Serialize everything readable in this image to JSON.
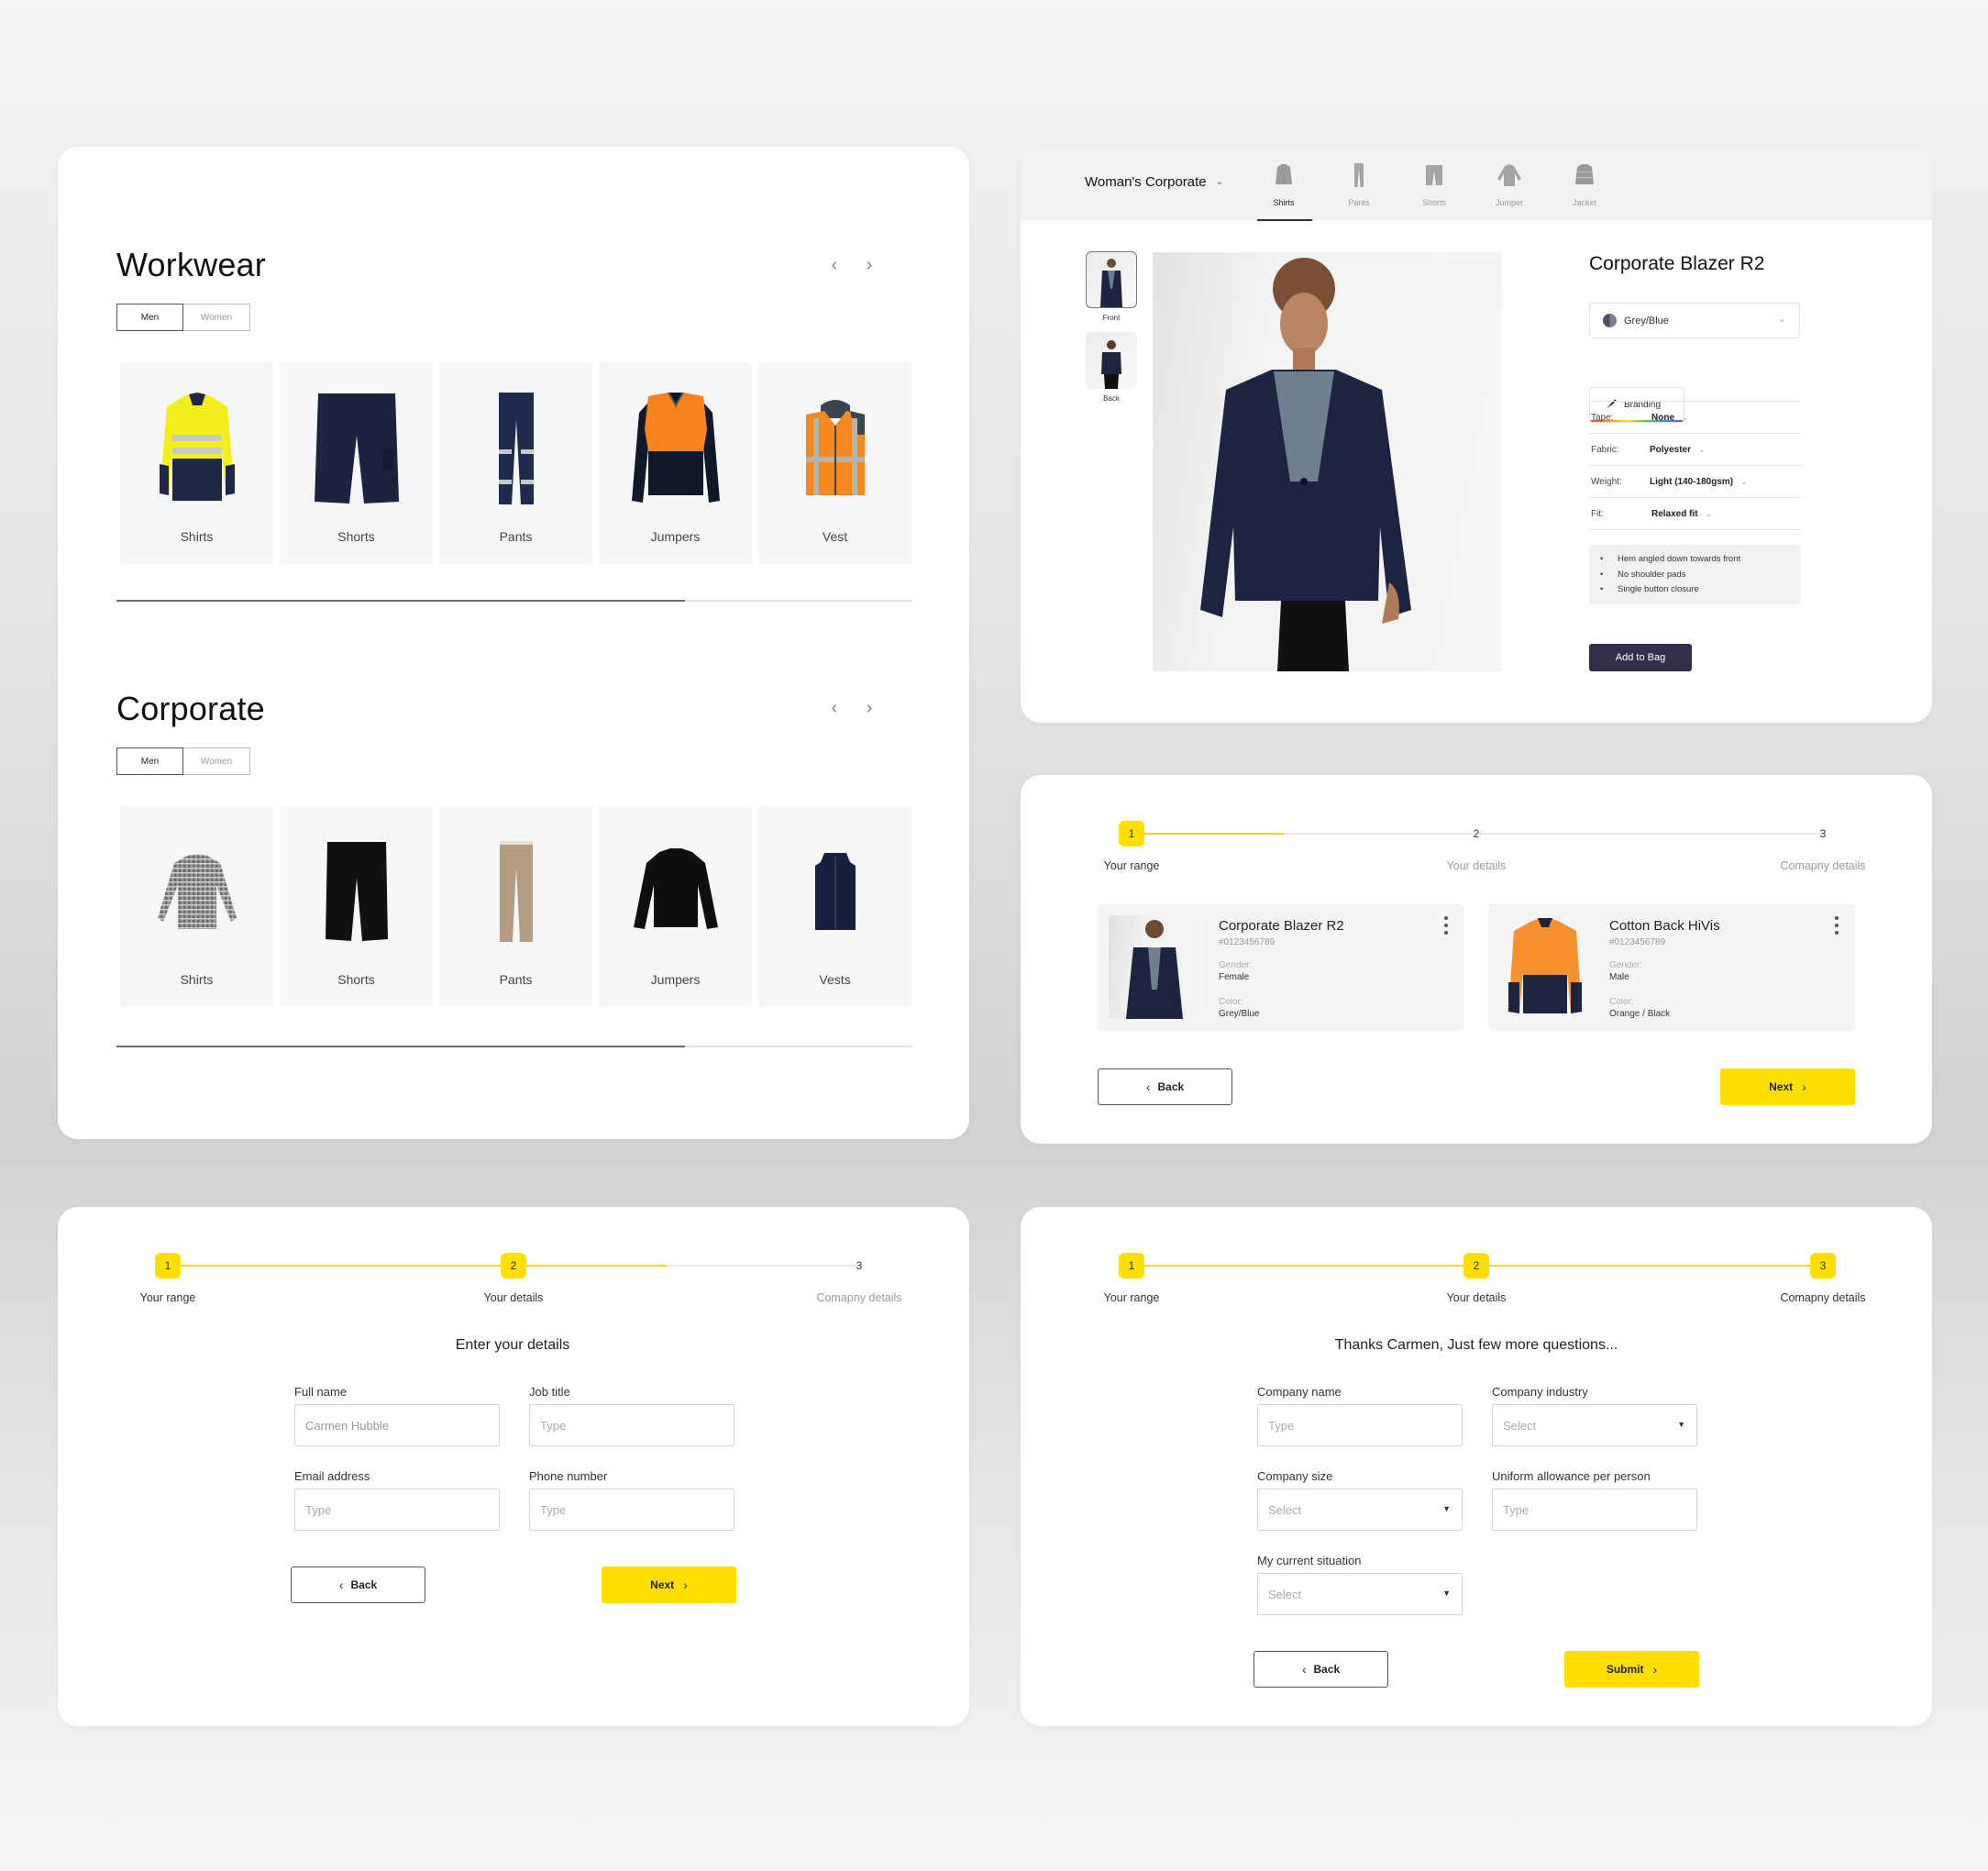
{
  "catalog": {
    "sections": [
      {
        "title": "Workwear",
        "toggle": [
          "Men",
          "Women"
        ],
        "active_toggle": "Men",
        "items": [
          "Shirts",
          "Shorts",
          "Pants",
          "Jumpers",
          "Vest"
        ],
        "scroll_progress": 0.714
      },
      {
        "title": "Corporate",
        "toggle": [
          "Men",
          "Women"
        ],
        "active_toggle": "Men",
        "items": [
          "Shirts",
          "Shorts",
          "Pants",
          "Jumpers",
          "Vests"
        ],
        "scroll_progress": 0.714
      }
    ],
    "prev_icon": "chevron-left-icon",
    "next_icon": "chevron-right-icon"
  },
  "product": {
    "category": "Woman's Corporate",
    "tabs": [
      {
        "label": "Shirts",
        "icon": "shirt-icon"
      },
      {
        "label": "Pants",
        "icon": "pants-icon"
      },
      {
        "label": "Shorts",
        "icon": "shorts-icon"
      },
      {
        "label": "Jumper",
        "icon": "jumper-icon"
      },
      {
        "label": "Jacket",
        "icon": "jacket-icon"
      }
    ],
    "active_tab": "Shirts",
    "thumbnails": [
      "Front",
      "Back"
    ],
    "title": "Corporate Blazer R2",
    "color": "Grey/Blue",
    "branding_label": "Branding",
    "specs": [
      {
        "key": "Tape:",
        "value": "None"
      },
      {
        "key": "Fabric:",
        "value": "Polyester"
      },
      {
        "key": "Weight:",
        "value": "Light (140-180gsm)"
      },
      {
        "key": "Fit:",
        "value": "Relaxed fit"
      }
    ],
    "features": [
      "Hem angled down towards front",
      "No shoulder pads",
      "Single button closure"
    ],
    "add_to_bag": "Add to Bag",
    "colors": {
      "button": "#2e3147"
    }
  },
  "steps": {
    "labels": [
      "Your range",
      "Your details",
      "Comapny details"
    ],
    "numbers": [
      "1",
      "2",
      "3"
    ],
    "accent": "#ffdf00"
  },
  "cart": {
    "current_step": 1,
    "items": [
      {
        "name": "Corporate Blazer R2",
        "sku": "#0123456789",
        "gender_label": "Gender:",
        "gender": "Female",
        "color_label": "Color:",
        "color": "Grey/Blue"
      },
      {
        "name": "Cotton Back HiVis",
        "sku": "#0123456789",
        "gender_label": "Gender:",
        "gender": "Male",
        "color_label": "Color:",
        "color": "Orange / Black"
      }
    ],
    "back": "Back",
    "next": "Next"
  },
  "details": {
    "current_step": 2,
    "heading": "Enter your details",
    "fields": [
      {
        "label": "Full name",
        "value": "Carmen Hubble"
      },
      {
        "label": "Job title",
        "placeholder": "Type"
      },
      {
        "label": "Email address",
        "placeholder": "Type"
      },
      {
        "label": "Phone number",
        "placeholder": "Type"
      }
    ],
    "back": "Back",
    "next": "Next"
  },
  "company": {
    "current_step": 3,
    "heading": "Thanks Carmen,  Just few more questions...",
    "fields": [
      {
        "label": "Company name",
        "placeholder": "Type",
        "type": "text"
      },
      {
        "label": "Company industry",
        "placeholder": "Select",
        "type": "select"
      },
      {
        "label": "Company size",
        "placeholder": "Select",
        "type": "select"
      },
      {
        "label": "Uniform allowance per person",
        "placeholder": "Type",
        "type": "text"
      },
      {
        "label": "My current situation",
        "placeholder": "Select",
        "type": "select"
      }
    ],
    "back": "Back",
    "submit": "Submit"
  }
}
